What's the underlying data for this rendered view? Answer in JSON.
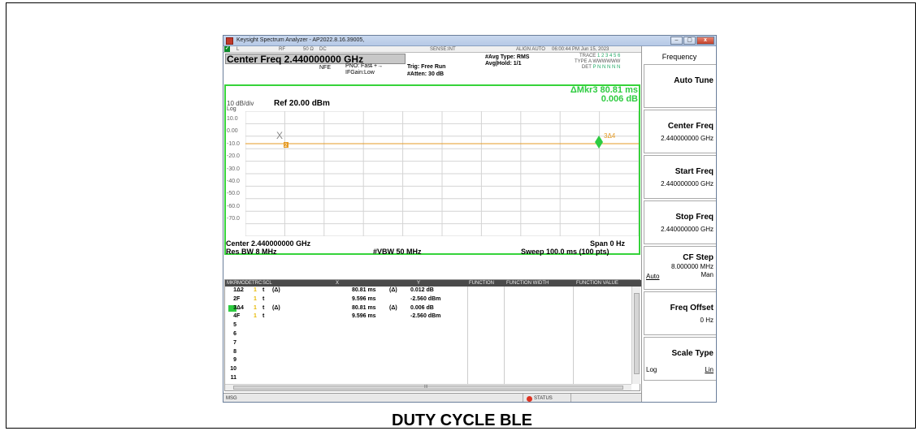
{
  "caption": "DUTY CYCLE BLE",
  "window": {
    "title": "Keysight Spectrum Analyzer - AP2022.8.16.39005,",
    "minimize": "–",
    "maximize": "▢",
    "close": "x"
  },
  "strip": {
    "mode": "L",
    "rf": "RF",
    "impedance": "50 Ω",
    "coupling": "DC",
    "sense": "SENSE:INT",
    "align": "ALIGN AUTO",
    "datetime": "06:00:44 PM Jun 15, 2023"
  },
  "header": {
    "center_freq": "Center Freq 2.440000000 GHz",
    "nfe": "NFE",
    "pno": "PNO: Fast",
    "ifgain": "IFGain:Low",
    "trig": "Trig: Free Run",
    "atten": "#Atten: 30 dB",
    "avg_type": "#Avg Type: RMS",
    "avg_hold": "Avg|Hold: 1/1",
    "trace_label": "TRACE",
    "trace_nums": "1 2 3 4 5 6",
    "type_label": "TYPE",
    "type_val": "A WWWWWW",
    "det_label": "DET",
    "det_val": "P N N N N N"
  },
  "display": {
    "marker_line1": "ΔMkr3 80.81 ms",
    "marker_line2": "0.006 dB",
    "scale": "10 dB/div",
    "ref": "Ref 20.00 dBm",
    "log": "Log",
    "y_ticks": [
      "10.0",
      "0.00",
      "-10.0",
      "-20.0",
      "-30.0",
      "-40.0",
      "-50.0",
      "-60.0",
      "-70.0"
    ],
    "marker_left": "X",
    "marker_left_tag": "2",
    "marker_right_tag": "3Δ4",
    "trace_color": "#e69b24",
    "marker_color": "#2ecc40"
  },
  "footer": {
    "center": "Center 2.440000000 GHz",
    "span": "Span 0 Hz",
    "res_bw": "Res BW 8 MHz",
    "vbw": "#VBW 50 MHz",
    "sweep": "Sweep 100.0 ms (100 pts)"
  },
  "marker_table": {
    "headers": [
      "MKR",
      "MODE",
      "TRC",
      "SCL",
      "X",
      "Y",
      "FUNCTION",
      "FUNCTION WIDTH",
      "FUNCTION VALUE"
    ],
    "rows": [
      {
        "n": "1",
        "mode": "Δ2",
        "trc": "1",
        "scl": "t",
        "ref": "(Δ)",
        "x": "80.81 ms",
        "xref": "(Δ)",
        "y": "0.012 dB"
      },
      {
        "n": "2",
        "mode": "F",
        "trc": "1",
        "scl": "t",
        "ref": "",
        "x": "9.596 ms",
        "xref": "",
        "y": "-2.560 dBm"
      },
      {
        "n": "3",
        "mode": "Δ4",
        "trc": "1",
        "scl": "t",
        "ref": "(Δ)",
        "x": "80.81 ms",
        "xref": "(Δ)",
        "y": "0.006 dB"
      },
      {
        "n": "4",
        "mode": "F",
        "trc": "1",
        "scl": "t",
        "ref": "",
        "x": "9.596 ms",
        "xref": "",
        "y": "-2.560 dBm"
      },
      {
        "n": "5",
        "mode": "",
        "trc": "",
        "scl": "",
        "ref": "",
        "x": "",
        "xref": "",
        "y": ""
      },
      {
        "n": "6",
        "mode": "",
        "trc": "",
        "scl": "",
        "ref": "",
        "x": "",
        "xref": "",
        "y": ""
      },
      {
        "n": "7",
        "mode": "",
        "trc": "",
        "scl": "",
        "ref": "",
        "x": "",
        "xref": "",
        "y": ""
      },
      {
        "n": "8",
        "mode": "",
        "trc": "",
        "scl": "",
        "ref": "",
        "x": "",
        "xref": "",
        "y": ""
      },
      {
        "n": "9",
        "mode": "",
        "trc": "",
        "scl": "",
        "ref": "",
        "x": "",
        "xref": "",
        "y": ""
      },
      {
        "n": "10",
        "mode": "",
        "trc": "",
        "scl": "",
        "ref": "",
        "x": "",
        "xref": "",
        "y": ""
      },
      {
        "n": "11",
        "mode": "",
        "trc": "",
        "scl": "",
        "ref": "",
        "x": "",
        "xref": "",
        "y": ""
      }
    ],
    "selected_row": 2,
    "hscroll_mark": "III"
  },
  "msgbar": {
    "msg": "MSG",
    "status": "STATUS"
  },
  "softkeys": {
    "menu_title": "Frequency",
    "auto_tune": "Auto Tune",
    "center_freq": "Center Freq",
    "center_freq_val": "2.440000000 GHz",
    "start_freq": "Start Freq",
    "start_freq_val": "2.440000000 GHz",
    "stop_freq": "Stop Freq",
    "stop_freq_val": "2.440000000 GHz",
    "cf_step": "CF Step",
    "cf_step_val": "8.000000 MHz",
    "cf_auto": "Auto",
    "cf_man": "Man",
    "freq_offset": "Freq Offset",
    "freq_offset_val": "0 Hz",
    "scale_type": "Scale Type",
    "scale_log": "Log",
    "scale_lin": "Lin"
  }
}
